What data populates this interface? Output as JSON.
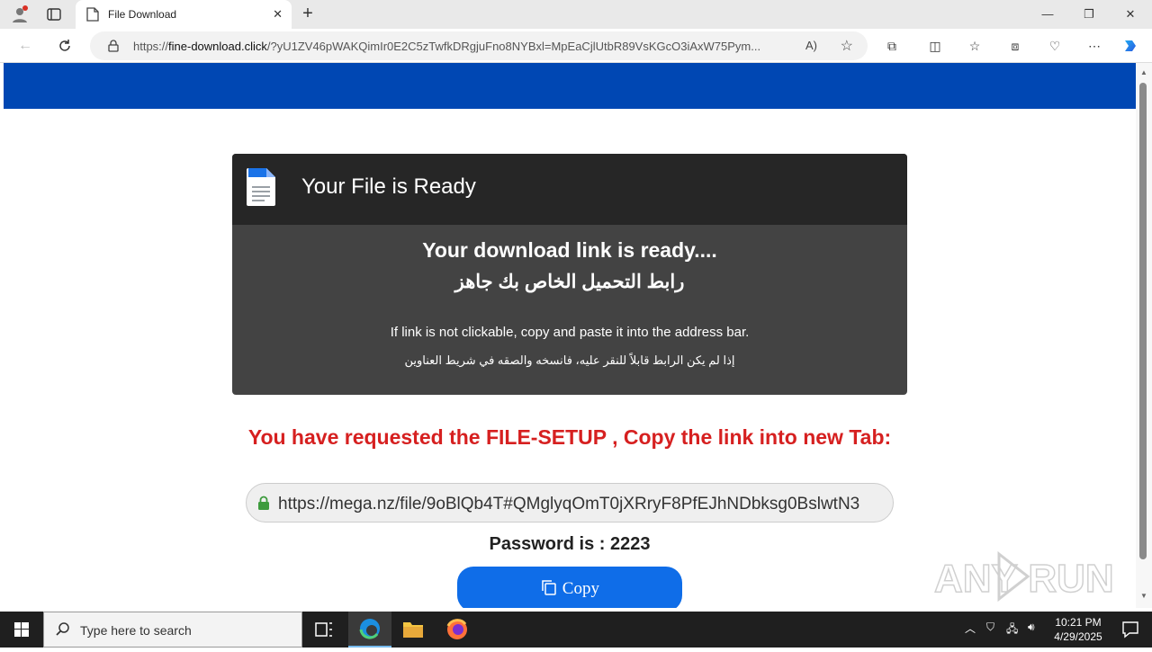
{
  "browser": {
    "tab_title": "File Download",
    "new_tab": "+",
    "url_prefix": "https://",
    "url_domain": "fine-download.click",
    "url_rest": "/?yU1ZV46pWAKQimIr0E2C5zTwfkDRgjuFno8NYBxl=MpEaCjlUtbR89VsKGcO3iAxW75Pym...",
    "read_aloud": "A)"
  },
  "page": {
    "card_title": "Your File is Ready",
    "ready_en": "Your download link is ready....",
    "ready_ar": "رابط التحميل الخاص بك جاهز",
    "hint_en": "If link is not clickable, copy and paste it into the address bar.",
    "hint_ar": "إذا لم يكن الرابط قابلاً للنقر عليه، فانسخه والصقه في شريط العناوين",
    "request_text": "You have requested the FILE-SETUP , Copy the link into new Tab:",
    "link": "https://mega.nz/file/9oBlQb4T#QMglyqOmT0jXRryF8PfEJhNDbksg0BslwtN3",
    "password": "Password is : 2223",
    "copy_label": "Copy"
  },
  "watermark": "ANY RUN",
  "taskbar": {
    "search_placeholder": "Type here to search",
    "time": "10:21 PM",
    "date": "4/29/2025"
  },
  "colors": {
    "brand_blue": "#0047b3",
    "card_bg": "#434343",
    "card_header": "#262626",
    "request_red": "#d62020",
    "copy_button": "#0f6de8"
  }
}
